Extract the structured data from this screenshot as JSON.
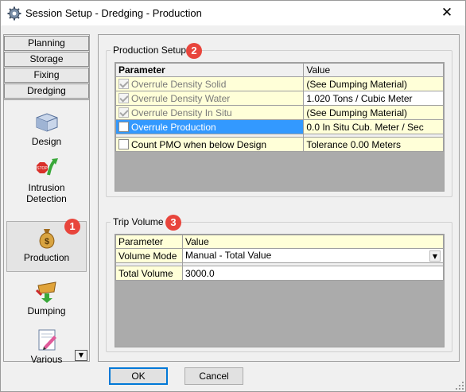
{
  "window": {
    "title": "Session Setup - Dredging -  Production",
    "close_glyph": "✕"
  },
  "nav": {
    "tabs": [
      "Planning",
      "Storage",
      "Fixing",
      "Dredging"
    ],
    "items": [
      {
        "label": "Design",
        "icon": "design-box-icon"
      },
      {
        "label": "Intrusion\nDetection",
        "icon": "intrusion-stop-icon"
      },
      {
        "label": "Production",
        "icon": "money-bag-icon",
        "selected": true
      },
      {
        "label": "Dumping",
        "icon": "dumping-arrow-icon"
      },
      {
        "label": "Various",
        "icon": "edit-pencil-icon"
      }
    ],
    "scroll_glyph": "▼"
  },
  "production_setup": {
    "title": "Production Setup",
    "badge": "2",
    "headers": {
      "param": "Parameter",
      "value": "Value"
    },
    "rows": [
      {
        "param": "Overrule Density Solid",
        "value": "(See Dumping Material)"
      },
      {
        "param": "Overrule Density Water",
        "value": "1.020 Tons / Cubic Meter"
      },
      {
        "param": "Overrule Density In Situ",
        "value": "(See Dumping Material)"
      },
      {
        "param": "Overrule Production",
        "value": "0.0 In Situ Cub. Meter / Sec"
      },
      {
        "param": "Count PMO when below Design",
        "value": "Tolerance 0.00 Meters"
      }
    ]
  },
  "trip_volume": {
    "title": "Trip Volume",
    "badge": "3",
    "headers": {
      "param": "Parameter",
      "value": "Value"
    },
    "rows": [
      {
        "param": "Volume Mode",
        "value": "Manual - Total Value"
      },
      {
        "param": "Total Volume",
        "value": "3000.0"
      }
    ]
  },
  "nav_badge": "1",
  "buttons": {
    "ok": "OK",
    "cancel": "Cancel"
  },
  "colors": {
    "badge": "#e8453c",
    "selection": "#3399ff",
    "highlight_row": "#ffffd8"
  }
}
